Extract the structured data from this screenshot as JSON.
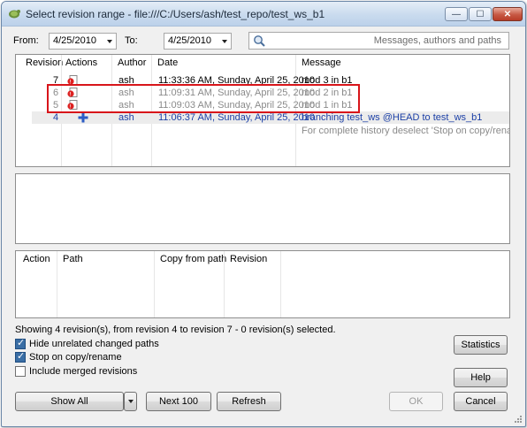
{
  "window": {
    "title": "Select revision range - file:///C:/Users/ash/test_repo/test_ws_b1"
  },
  "filters": {
    "from_label": "From:",
    "from_value": "4/25/2010",
    "to_label": "To:",
    "to_value": "4/25/2010",
    "search_placeholder": "Messages, authors and paths"
  },
  "log": {
    "columns": [
      "Revision",
      "Actions",
      "Author",
      "Date",
      "Message"
    ],
    "rows": [
      {
        "revision": "7",
        "author": "ash",
        "date": "11:33:36 AM, Sunday, April 25, 2010",
        "message": "mod 3 in b1"
      },
      {
        "revision": "6",
        "author": "ash",
        "date": "11:09:31 AM, Sunday, April 25, 2010",
        "message": "mod 2 in b1"
      },
      {
        "revision": "5",
        "author": "ash",
        "date": "11:09:03 AM, Sunday, April 25, 2010",
        "message": "mod 1 in b1"
      },
      {
        "revision": "4",
        "author": "ash",
        "date": "11:06:37 AM, Sunday, April 25, 2010",
        "message": "branching test_ws @HEAD to test_ws_b1"
      }
    ],
    "note": "For complete history deselect 'Stop on copy/rename'"
  },
  "paths": {
    "columns": [
      "Action",
      "Path",
      "Copy from path",
      "Revision"
    ]
  },
  "status_text": "Showing 4 revision(s), from revision 4 to revision 7 - 0 revision(s) selected.",
  "options": {
    "hide_unrelated": {
      "label": "Hide unrelated changed paths",
      "checked": true
    },
    "stop_on_copy": {
      "label": "Stop on copy/rename",
      "checked": true
    },
    "include_merged": {
      "label": "Include merged revisions",
      "checked": false
    }
  },
  "buttons": {
    "statistics": "Statistics",
    "help": "Help",
    "show_all": "Show All",
    "next_100": "Next 100",
    "refresh": "Refresh",
    "ok": "OK",
    "cancel": "Cancel"
  },
  "colors": {
    "highlight": "#d8151a",
    "link_blue": "#1b3fa6",
    "selected_row": "#ececec"
  }
}
